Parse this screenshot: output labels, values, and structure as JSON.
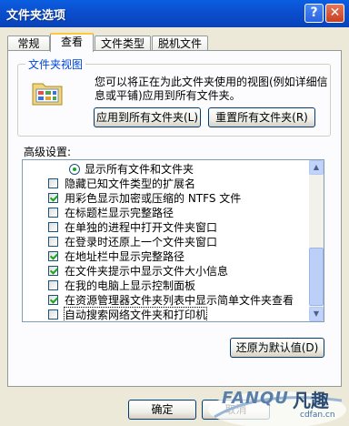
{
  "window": {
    "title": "文件夹选项",
    "help_label": "?",
    "close_label": "✕"
  },
  "tabs": [
    {
      "label": "常规"
    },
    {
      "label": "查看"
    },
    {
      "label": "文件类型"
    },
    {
      "label": "脱机文件"
    }
  ],
  "folder_view": {
    "label": "文件夹视图",
    "description": "您可以将正在为此文件夹使用的视图(例如详细信息或平铺)应用到所有文件夹。",
    "apply_all_label": "应用到所有文件夹(L)",
    "reset_all_label": "重置所有文件夹(R)",
    "icon": "folder-view-icon"
  },
  "advanced": {
    "label": "高级设置:",
    "items": [
      {
        "type": "radio",
        "text": "显示所有文件和文件夹",
        "checked": true
      },
      {
        "type": "checkbox",
        "text": "隐藏已知文件类型的扩展名",
        "checked": false
      },
      {
        "type": "checkbox",
        "text": "用彩色显示加密或压缩的 NTFS 文件",
        "checked": true
      },
      {
        "type": "checkbox",
        "text": "在标题栏显示完整路径",
        "checked": false
      },
      {
        "type": "checkbox",
        "text": "在单独的进程中打开文件夹窗口",
        "checked": false
      },
      {
        "type": "checkbox",
        "text": "在登录时还原上一个文件夹窗口",
        "checked": false
      },
      {
        "type": "checkbox",
        "text": "在地址栏中显示完整路径",
        "checked": true
      },
      {
        "type": "checkbox",
        "text": "在文件夹提示中显示文件大小信息",
        "checked": true
      },
      {
        "type": "checkbox",
        "text": "在我的电脑上显示控制面板",
        "checked": false
      },
      {
        "type": "checkbox",
        "text": "在资源管理器文件夹列表中显示简单文件夹查看",
        "checked": true
      },
      {
        "type": "checkbox",
        "text": "自动搜索网络文件夹和打印机",
        "checked": false,
        "selected": true
      }
    ]
  },
  "restore_defaults_label": "还原为默认值(D)",
  "ok_label": "确定",
  "cancel_label": "取消",
  "watermark": {
    "brand": "FANQU",
    "cn": "凡趣",
    "sub": "cdfan.cn"
  }
}
